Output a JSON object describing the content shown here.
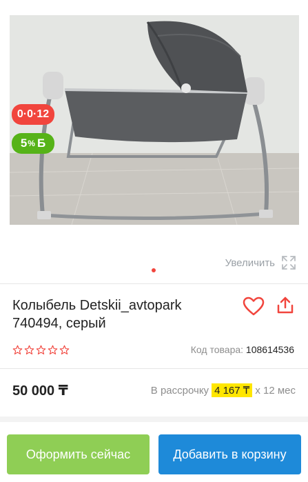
{
  "product": {
    "title": "Колыбель Detskii_avtopark 740494, серый",
    "rating_stars": 0,
    "code_label": "Код товара:",
    "code_value": "108614536",
    "price": "50 000 ₸",
    "installment_label": "В рассрочку",
    "installment_monthly": "4 167 ₸",
    "installment_term": "x 12 мес"
  },
  "gallery": {
    "zoom_label": "Увеличить",
    "active_slide": 1,
    "slide_count": 1,
    "badges": {
      "installment": "0·0·12",
      "bonus_value": "5",
      "bonus_pct": "%",
      "bonus_letter": "Б"
    }
  },
  "actions": {
    "buy_now": "Оформить сейчас",
    "add_to_cart": "Добавить в корзину"
  },
  "icons": {
    "favorite": "heart-icon",
    "share": "share-icon",
    "zoom": "expand-icon",
    "star": "star-outline-icon"
  },
  "colors": {
    "accent_red": "#f1453d",
    "bonus_green": "#56b318",
    "buy_button": "#8fce55",
    "cart_button": "#1e8ad9",
    "installment_highlight": "#ffe600"
  }
}
